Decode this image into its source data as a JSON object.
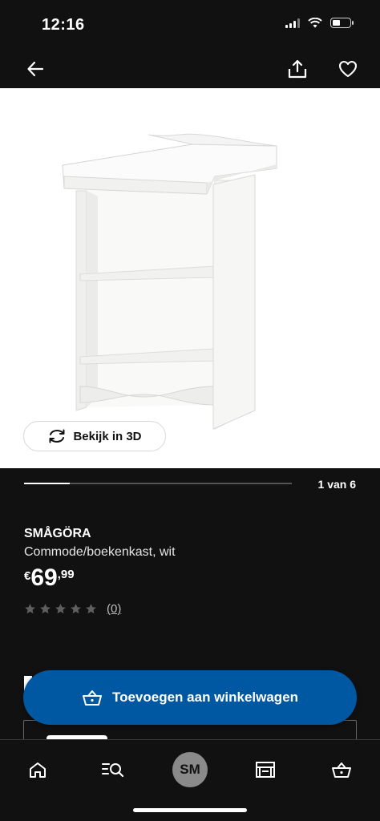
{
  "status": {
    "time": "12:16"
  },
  "header": {
    "back_icon": "arrow-left-icon",
    "share_icon": "share-icon",
    "favorite_icon": "heart-icon"
  },
  "gallery": {
    "view_3d_label": "Bekijk in 3D",
    "counter": "1 van 6",
    "progress": 0.17
  },
  "product": {
    "name": "SMÅGÖRA",
    "description": "Commode/boekenkast, wit",
    "price_currency": "€",
    "price_integer": "69",
    "price_decimal": ",99",
    "rating_stars": 0,
    "rating_count": "(0)"
  },
  "cta": {
    "add_to_cart_label": "Toevoegen aan winkelwagen"
  },
  "bottom_nav": {
    "items": [
      {
        "icon": "home-icon"
      },
      {
        "icon": "search-icon"
      },
      {
        "avatar": "SM"
      },
      {
        "icon": "store-icon"
      },
      {
        "icon": "cart-icon"
      }
    ]
  },
  "colors": {
    "accent": "#0058a3",
    "background": "#111111"
  }
}
